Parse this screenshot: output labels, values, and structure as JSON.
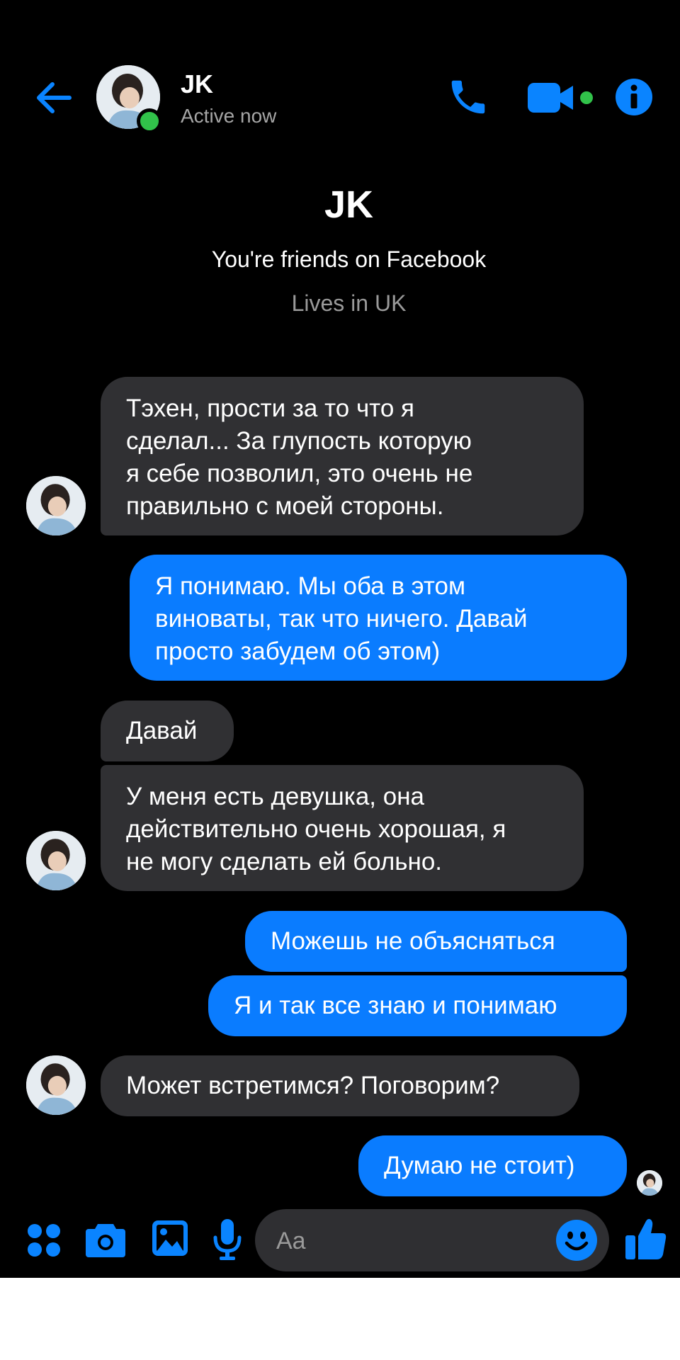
{
  "header": {
    "contact_name": "JK",
    "status": "Active now"
  },
  "profile": {
    "name": "JK",
    "friends_text": "You're friends on Facebook",
    "location_text": "Lives in UK"
  },
  "messages": [
    {
      "side": "incoming",
      "lines": [
        "Тэхен, прости за то что я",
        "сделал... За глупость которую",
        "я себе позволил, это очень не",
        "правильно с моей стороны."
      ]
    },
    {
      "side": "outgoing",
      "lines": [
        "Я понимаю. Мы оба в этом",
        "виноваты, так что ничего. Давай",
        "просто забудем об этом)"
      ]
    },
    {
      "side": "incoming",
      "lines": [
        "Давай"
      ]
    },
    {
      "side": "incoming",
      "lines": [
        "У меня есть девушка, она",
        "действительно очень хорошая, я",
        "не могу сделать ей больно."
      ]
    },
    {
      "side": "outgoing",
      "lines": [
        "Можешь не объясняться"
      ]
    },
    {
      "side": "outgoing",
      "lines": [
        "Я и так все знаю и понимаю"
      ]
    },
    {
      "side": "incoming",
      "lines": [
        "Может встретимся? Поговорим?"
      ]
    },
    {
      "side": "outgoing",
      "lines": [
        "Думаю не стоит)"
      ]
    }
  ],
  "composer": {
    "placeholder": "Aa"
  },
  "icons": {
    "back": "back-arrow-icon",
    "call": "phone-icon",
    "video": "video-camera-icon",
    "info": "info-icon",
    "apps": "apps-grid-icon",
    "camera": "camera-icon",
    "gallery": "image-icon",
    "voice": "microphone-icon",
    "emoji": "emoji-icon",
    "like": "thumbs-up-icon"
  },
  "colors": {
    "background": "#000000",
    "accent": "#0a84ff",
    "incoming_bubble": "#303033",
    "outgoing_bubble": "#0a7cff",
    "online": "#31c24a"
  }
}
